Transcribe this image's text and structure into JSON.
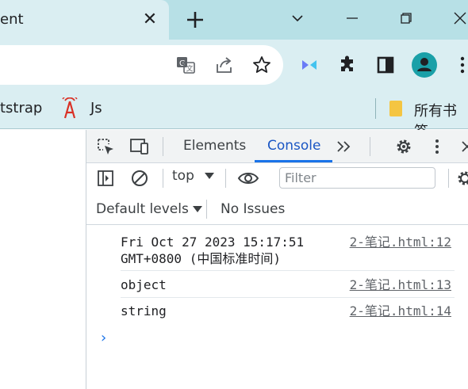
{
  "browser": {
    "tab": {
      "title": "ent",
      "close_glyph": "✕"
    },
    "new_tab_glyph": "+",
    "window_controls": [
      "chevron-down",
      "minimize",
      "restore",
      "close"
    ],
    "toolbar_icons": [
      "translate-icon",
      "share-icon",
      "star-icon",
      "extension-m-icon",
      "puzzle-icon",
      "sidebar-icon",
      "profile-icon",
      "more-icon"
    ],
    "accent": "#1a73e8"
  },
  "bookmarks": {
    "items": [
      {
        "label": "tstrap"
      },
      {
        "label": "Js"
      }
    ],
    "all_bookmarks": "所有书签"
  },
  "devtools": {
    "tabs": [
      {
        "label": "Elements"
      },
      {
        "label": "Console"
      }
    ],
    "context": "top",
    "filter_placeholder": "Filter",
    "levels_label": "Default levels",
    "issues_label": "No Issues",
    "logs": [
      {
        "message": "Fri Oct 27 2023 15:17:51\nGMT+0800 (中国标准时间)",
        "source": "2-笔记.html:12"
      },
      {
        "message": "object",
        "source": "2-笔记.html:13"
      },
      {
        "message": "string",
        "source": "2-笔记.html:14"
      }
    ],
    "prompt_glyph": "›"
  }
}
